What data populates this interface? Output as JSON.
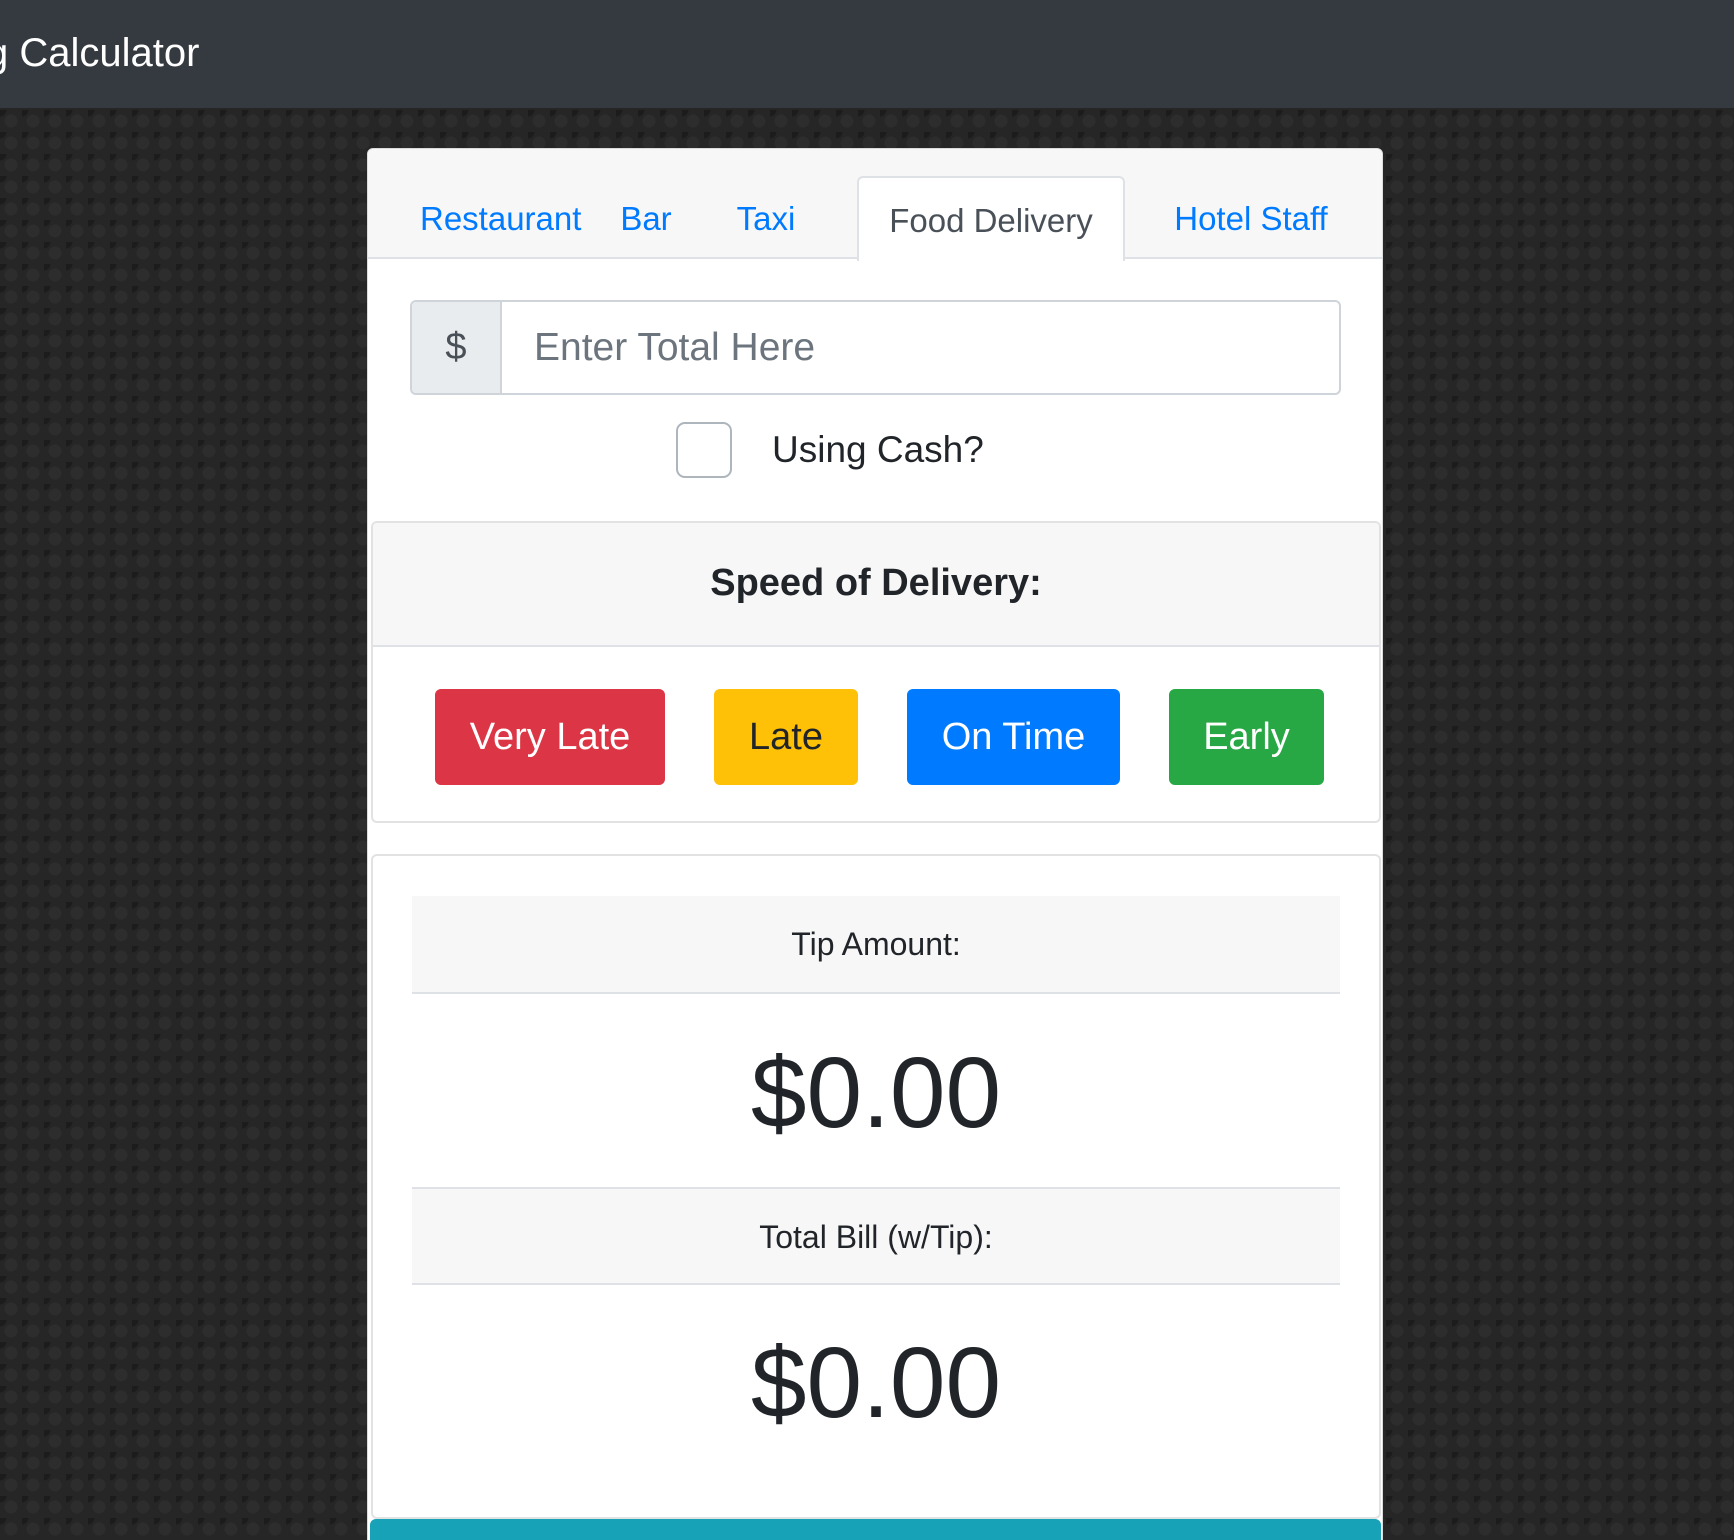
{
  "navbar": {
    "brand": "g Calculator"
  },
  "tabs": [
    {
      "label": "Restaurant",
      "active": false
    },
    {
      "label": "Bar",
      "active": false
    },
    {
      "label": "Taxi",
      "active": false
    },
    {
      "label": "Food Delivery",
      "active": true
    },
    {
      "label": "Hotel Staff",
      "active": false
    }
  ],
  "total_input": {
    "prefix": "$",
    "placeholder": "Enter Total Here",
    "value": ""
  },
  "cash": {
    "label": "Using Cash?",
    "checked": false
  },
  "speed": {
    "title": "Speed of Delivery:",
    "options": [
      {
        "label": "Very Late",
        "color": "#dc3545"
      },
      {
        "label": "Late",
        "color": "#ffc107"
      },
      {
        "label": "On Time",
        "color": "#007bff"
      },
      {
        "label": "Early",
        "color": "#28a745"
      }
    ]
  },
  "results": {
    "tip_label": "Tip Amount:",
    "tip_value": "$0.00",
    "total_label": "Total Bill (w/Tip):",
    "total_value": "$0.00"
  },
  "colors": {
    "navbar": "#343a40",
    "link": "#007bff",
    "footer_bar": "#17a2b8"
  }
}
